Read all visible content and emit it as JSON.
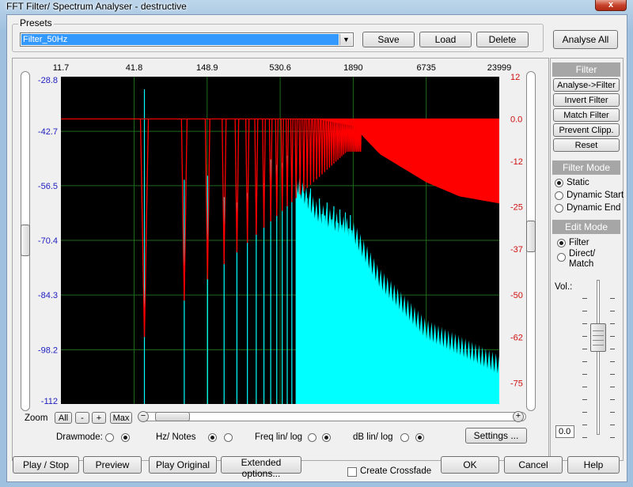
{
  "window": {
    "title": "FFT Filter/ Spectrum Analyser - destructive",
    "close_label": "x"
  },
  "presets": {
    "legend": "Presets",
    "selected": "Filter_50Hz",
    "save_label": "Save",
    "load_label": "Load",
    "delete_label": "Delete"
  },
  "analyse_all_label": "Analyse All",
  "chart_data": {
    "type": "spectrum",
    "top_axis_label": "",
    "left_axis_label": "",
    "right_axis_label": "",
    "x_ticks_hz": [
      "11.7",
      "41.8",
      "148.9",
      "530.6",
      "1890",
      "6735",
      "23999"
    ],
    "x_range_hz": [
      11.7,
      23999
    ],
    "x_scale": "log",
    "left_ticks": [
      "-28.8",
      "-42.7",
      "-56.5",
      "-70.4",
      "-84.3",
      "-98.2",
      "-112"
    ],
    "left_range": [
      -112,
      -28.8
    ],
    "right_ticks": [
      "12",
      "0.0",
      "-12",
      "-25",
      "-37",
      "-50",
      "-62",
      "-75"
    ],
    "right_range": [
      -81,
      12
    ],
    "grid": true,
    "background_color": "#000000",
    "grid_color": "#1f6b1f",
    "spectrum_color": "#00ffff",
    "filter_curve_color": "#ff0000",
    "filter_baseline": 0.0,
    "harmonics_base_hz": 50,
    "notch_depth_low": -62,
    "filter_shape": [
      {
        "hz": 11.7,
        "value": 0
      },
      {
        "hz": 1000,
        "value": 0
      },
      {
        "hz": 1890,
        "value": -2
      },
      {
        "hz": 3000,
        "value": -10
      },
      {
        "hz": 6735,
        "value": -18
      },
      {
        "hz": 12000,
        "value": -22
      },
      {
        "hz": 23999,
        "value": -24
      }
    ],
    "spectrum_envelope": [
      {
        "hz": 11.7,
        "value": -112
      },
      {
        "hz": 50,
        "value": -32
      },
      {
        "hz": 100,
        "value": -55
      },
      {
        "hz": 300,
        "value": -62
      },
      {
        "hz": 530.6,
        "value": -50
      },
      {
        "hz": 1000,
        "value": -63
      },
      {
        "hz": 1890,
        "value": -68
      },
      {
        "hz": 3000,
        "value": -80
      },
      {
        "hz": 6735,
        "value": -93
      },
      {
        "hz": 23999,
        "value": -102
      }
    ]
  },
  "filter_section": {
    "header": "Filter",
    "analyse_filter_label": "Analyse->Filter",
    "invert_filter_label": "Invert Filter",
    "match_filter_label": "Match Filter",
    "prevent_clipp_label": "Prevent Clipp.",
    "reset_label": "Reset"
  },
  "filter_mode": {
    "header": "Filter Mode",
    "options": [
      "Static",
      "Dynamic Start",
      "Dynamic End"
    ],
    "selected": "Static"
  },
  "edit_mode": {
    "header": "Edit Mode",
    "filter_label": "Filter",
    "direct_label": "Direct/",
    "match_label": "Match",
    "selected": "Filter"
  },
  "volume": {
    "label": "Vol.:",
    "value": "0.0"
  },
  "zoom": {
    "label": "Zoom",
    "all_label": "All",
    "minus_label": "-",
    "plus_label": "+",
    "max_label": "Max",
    "slider_minus": "−",
    "slider_plus": "+"
  },
  "options_row": {
    "drawmode_label": "Drawmode:",
    "hz_notes_label": "Hz/ Notes",
    "freq_label": "Freq lin/ log",
    "db_label": "dB lin/ log",
    "settings_label": "Settings ..."
  },
  "bottom": {
    "play_stop_label": "Play / Stop",
    "preview_label": "Preview",
    "play_original_label": "Play Original",
    "extended_label": "Extended options...",
    "crossfade_label": "Create Crossfade",
    "ok_label": "OK",
    "cancel_label": "Cancel",
    "help_label": "Help"
  }
}
